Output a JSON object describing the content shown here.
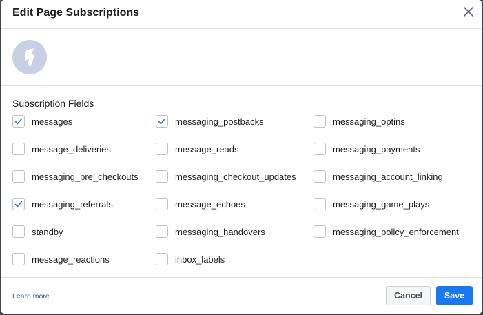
{
  "dialog": {
    "title": "Edit Page Subscriptions",
    "section_label": "Subscription Fields",
    "fields": [
      {
        "label": "messages",
        "checked": true
      },
      {
        "label": "messaging_postbacks",
        "checked": true
      },
      {
        "label": "messaging_optins",
        "checked": false
      },
      {
        "label": "message_deliveries",
        "checked": false
      },
      {
        "label": "message_reads",
        "checked": false
      },
      {
        "label": "messaging_payments",
        "checked": false
      },
      {
        "label": "messaging_pre_checkouts",
        "checked": false
      },
      {
        "label": "messaging_checkout_updates",
        "checked": false
      },
      {
        "label": "messaging_account_linking",
        "checked": false
      },
      {
        "label": "messaging_referrals",
        "checked": true
      },
      {
        "label": "message_echoes",
        "checked": false
      },
      {
        "label": "messaging_game_plays",
        "checked": false
      },
      {
        "label": "standby",
        "checked": false
      },
      {
        "label": "messaging_handovers",
        "checked": false
      },
      {
        "label": "messaging_policy_enforcement",
        "checked": false
      },
      {
        "label": "message_reactions",
        "checked": false
      },
      {
        "label": "inbox_labels",
        "checked": false
      }
    ],
    "learn_more": "Learn more",
    "cancel_label": "Cancel",
    "save_label": "Save"
  },
  "colors": {
    "accent": "#1877f2",
    "link": "#385898",
    "avatar_bg": "#c9d0e6"
  },
  "icons": {
    "close": "close-icon",
    "check": "checkmark-icon",
    "avatar": "page-avatar-icon"
  }
}
